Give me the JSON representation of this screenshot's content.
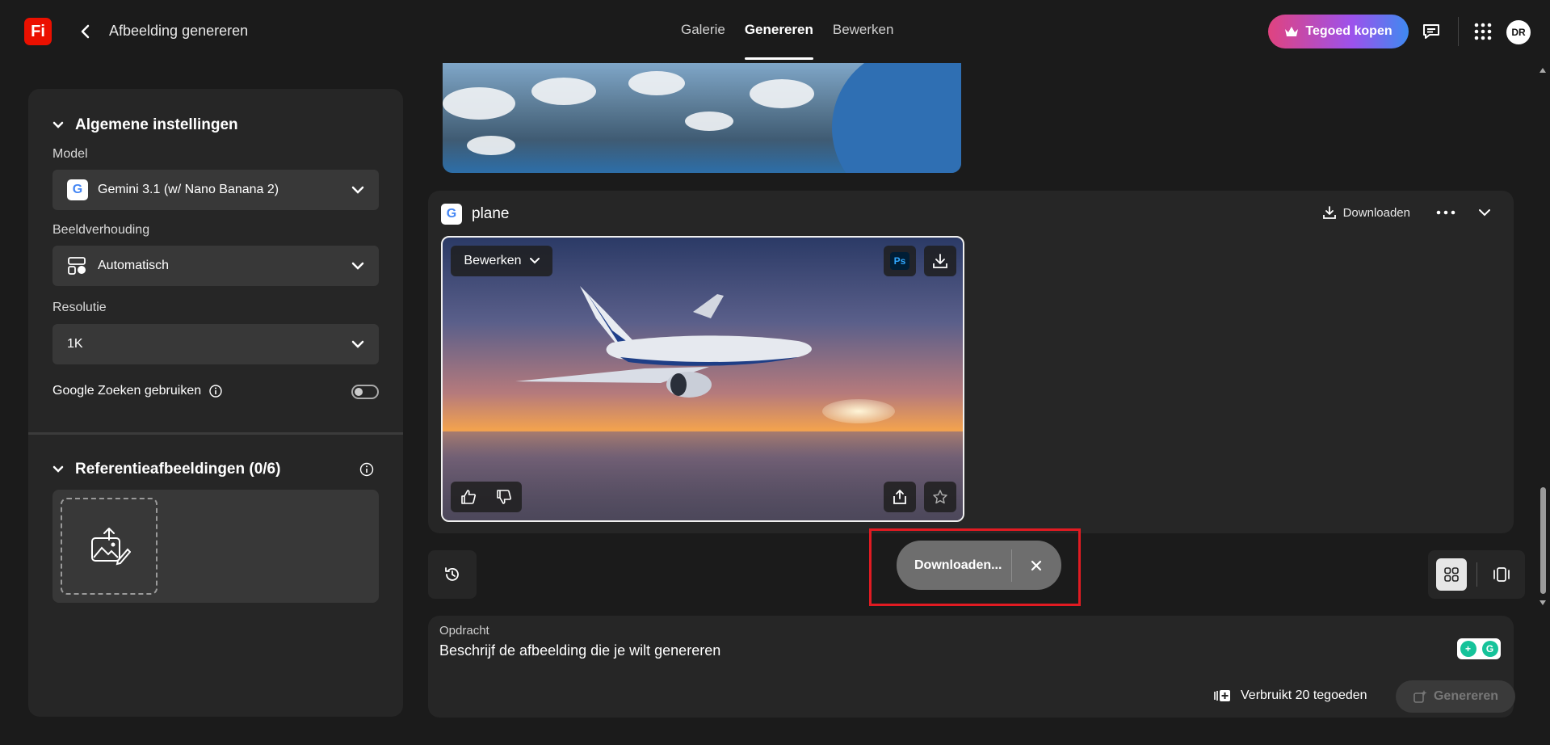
{
  "header": {
    "logo_text": "Fi",
    "back_icon": "chevron-left-icon",
    "title": "Afbeelding genereren",
    "tabs": [
      {
        "label": "Galerie",
        "active": false
      },
      {
        "label": "Genereren",
        "active": true
      },
      {
        "label": "Bewerken",
        "active": false
      }
    ],
    "buy_button": "Tegoed kopen",
    "avatar_initials": "DR"
  },
  "settings": {
    "general_title": "Algemene instellingen",
    "model_label": "Model",
    "model_value": "Gemini 3.1 (w/ Nano Banana 2)",
    "aspect_label": "Beeldverhouding",
    "aspect_value": "Automatisch",
    "resolution_label": "Resolutie",
    "resolution_value": "1K",
    "google_search_label": "Google Zoeken gebruiken",
    "google_search_enabled": false,
    "reference_title": "Referentieafbeeldingen (0/6)"
  },
  "result": {
    "prompt_title": "plane",
    "download_label": "Downloaden",
    "edit_dropdown": "Bewerken",
    "ps_badge": "Ps"
  },
  "toast": {
    "text": "Downloaden..."
  },
  "prompt": {
    "label": "Opdracht",
    "placeholder": "Beschrijf de afbeelding die je wilt genereren",
    "credits_text": "Verbruikt 20 tegoeden",
    "generate_label": "Genereren"
  },
  "colors": {
    "accent_red": "#eb1000",
    "highlight": "#e11b22"
  }
}
